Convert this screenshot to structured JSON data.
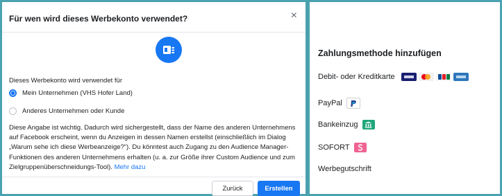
{
  "dialog": {
    "title": "Für wen wird dieses Werbekonto verwendet?",
    "close_glyph": "×",
    "section_label": "Dieses Werbekonto wird verwendet für",
    "options": [
      {
        "label": "Mein Unternehmen (VHS Hofer Land)",
        "selected": true
      },
      {
        "label": "Anderes Unternehmen oder Kunde",
        "selected": false
      }
    ],
    "description": "Diese Angabe ist wichtig. Dadurch wird sichergestellt, dass der Name des anderen Unternehmens auf Facebook erscheint, wenn du Anzeigen in dessen Namen erstellst (einschließlich im Dialog „Warum sehe ich diese Werbeanzeige?“). Du könntest auch Zugang zu den Audience Manager-Funktionen des anderen Unternehmens erhalten (u. a. zur Größe ihrer Custom Audience und zum Zielgruppenüberschneidungs-Tool).",
    "more_link": "Mehr dazu",
    "back_button": "Zurück",
    "create_button": "Erstellen",
    "hero_icon": "ad-account-icon"
  },
  "payment": {
    "title": "Zahlungsmethode hinzufügen",
    "methods": [
      {
        "label": "Debit- oder Kreditkarte",
        "icons": [
          "visa-icon",
          "mastercard-icon",
          "jcb-icon",
          "amex-icon"
        ]
      },
      {
        "label": "PayPal",
        "icons": [
          "paypal-icon"
        ]
      },
      {
        "label": "Bankeinzug",
        "icons": [
          "bank-icon"
        ]
      },
      {
        "label": "SOFORT",
        "icons": [
          "sofort-icon"
        ]
      },
      {
        "label": "Werbegutschrift",
        "icons": []
      }
    ]
  },
  "colors": {
    "background": "#4aa1b0",
    "accent": "#1877f2",
    "bank": "#1fa67a",
    "sofort": "#f06292"
  }
}
